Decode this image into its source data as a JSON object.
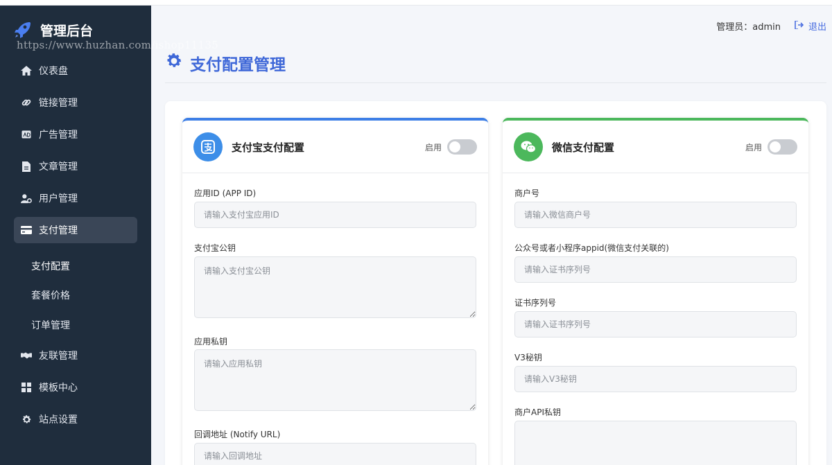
{
  "app": {
    "title": "管理后台",
    "watermark": "https://www.huzhan.com/ishop11135"
  },
  "nav": {
    "items": [
      {
        "label": "仪表盘",
        "icon": "home-icon"
      },
      {
        "label": "链接管理",
        "icon": "link-icon"
      },
      {
        "label": "广告管理",
        "icon": "ad-icon"
      },
      {
        "label": "文章管理",
        "icon": "file-icon"
      },
      {
        "label": "用户管理",
        "icon": "user-gear-icon"
      },
      {
        "label": "支付管理",
        "icon": "credit-card-icon"
      },
      {
        "label": "友联管理",
        "icon": "handshake-icon"
      },
      {
        "label": "模板中心",
        "icon": "grid-icon"
      },
      {
        "label": "站点设置",
        "icon": "gear-icon"
      }
    ],
    "sub_items": [
      "支付配置",
      "套餐价格",
      "订单管理"
    ]
  },
  "header": {
    "admin_text": "管理员：admin",
    "logout_label": "退出"
  },
  "page": {
    "title": "支付配置管理"
  },
  "alipay": {
    "title": "支付宝支付配置",
    "toggle_label": "启用",
    "fields": {
      "app_id_label": "应用ID (APP ID)",
      "app_id_placeholder": "请输入支付宝应用ID",
      "pubkey_label": "支付宝公钥",
      "pubkey_placeholder": "请输入支付宝公钥",
      "privkey_label": "应用私钥",
      "privkey_placeholder": "请输入应用私钥",
      "notify_label": "回调地址 (Notify URL)",
      "notify_placeholder": "请输入回调地址"
    }
  },
  "wechat": {
    "title": "微信支付配置",
    "toggle_label": "启用",
    "fields": {
      "mchid_label": "商户号",
      "mchid_placeholder": "请输入微信商户号",
      "appid_label": "公众号或者小程序appid(微信支付关联的)",
      "appid_placeholder": "请输入证书序列号",
      "serial_label": "证书序列号",
      "serial_placeholder": "请输入证书序列号",
      "v3key_label": "V3秘钥",
      "v3key_placeholder": "请输入V3秘钥",
      "apikey_label": "商户API私钥",
      "apikey_placeholder": ""
    }
  },
  "colors": {
    "sidebar_bg": "#1f2d3d",
    "accent_blue": "#3f68d8",
    "alipay_blue": "#3d8ee8",
    "wechat_green": "#4cb85c"
  }
}
